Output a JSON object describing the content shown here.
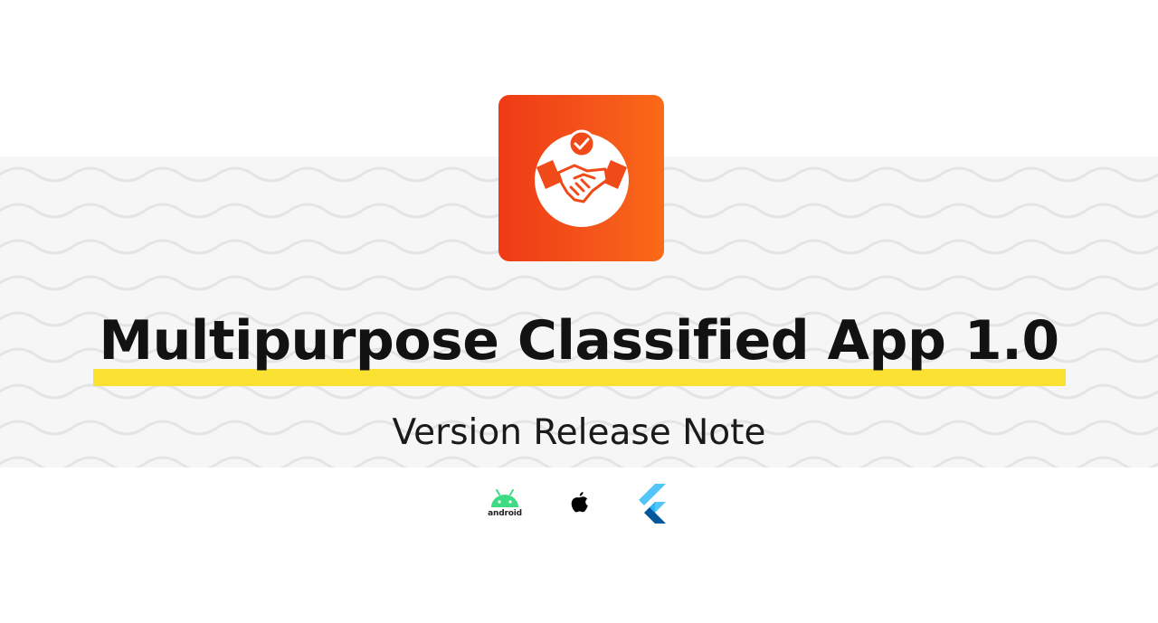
{
  "header": {
    "title": "Multipurpose Classified App 1.0",
    "subtitle": "Version Release Note"
  },
  "logo": {
    "icon": "handshake-icon",
    "badge_icon": "checkmark-icon",
    "colors": {
      "start": "#ef3a16",
      "end": "#fa6a18"
    }
  },
  "platforms": [
    {
      "name": "android",
      "icon": "android-icon",
      "label": "android",
      "color": "#3ddc84"
    },
    {
      "name": "apple",
      "icon": "apple-icon",
      "color": "#000000"
    },
    {
      "name": "flutter",
      "icon": "flutter-icon",
      "color": "#42a5f5"
    }
  ],
  "colors": {
    "highlight": "#fbe232",
    "title": "#121212",
    "band": "#f6f6f6"
  }
}
